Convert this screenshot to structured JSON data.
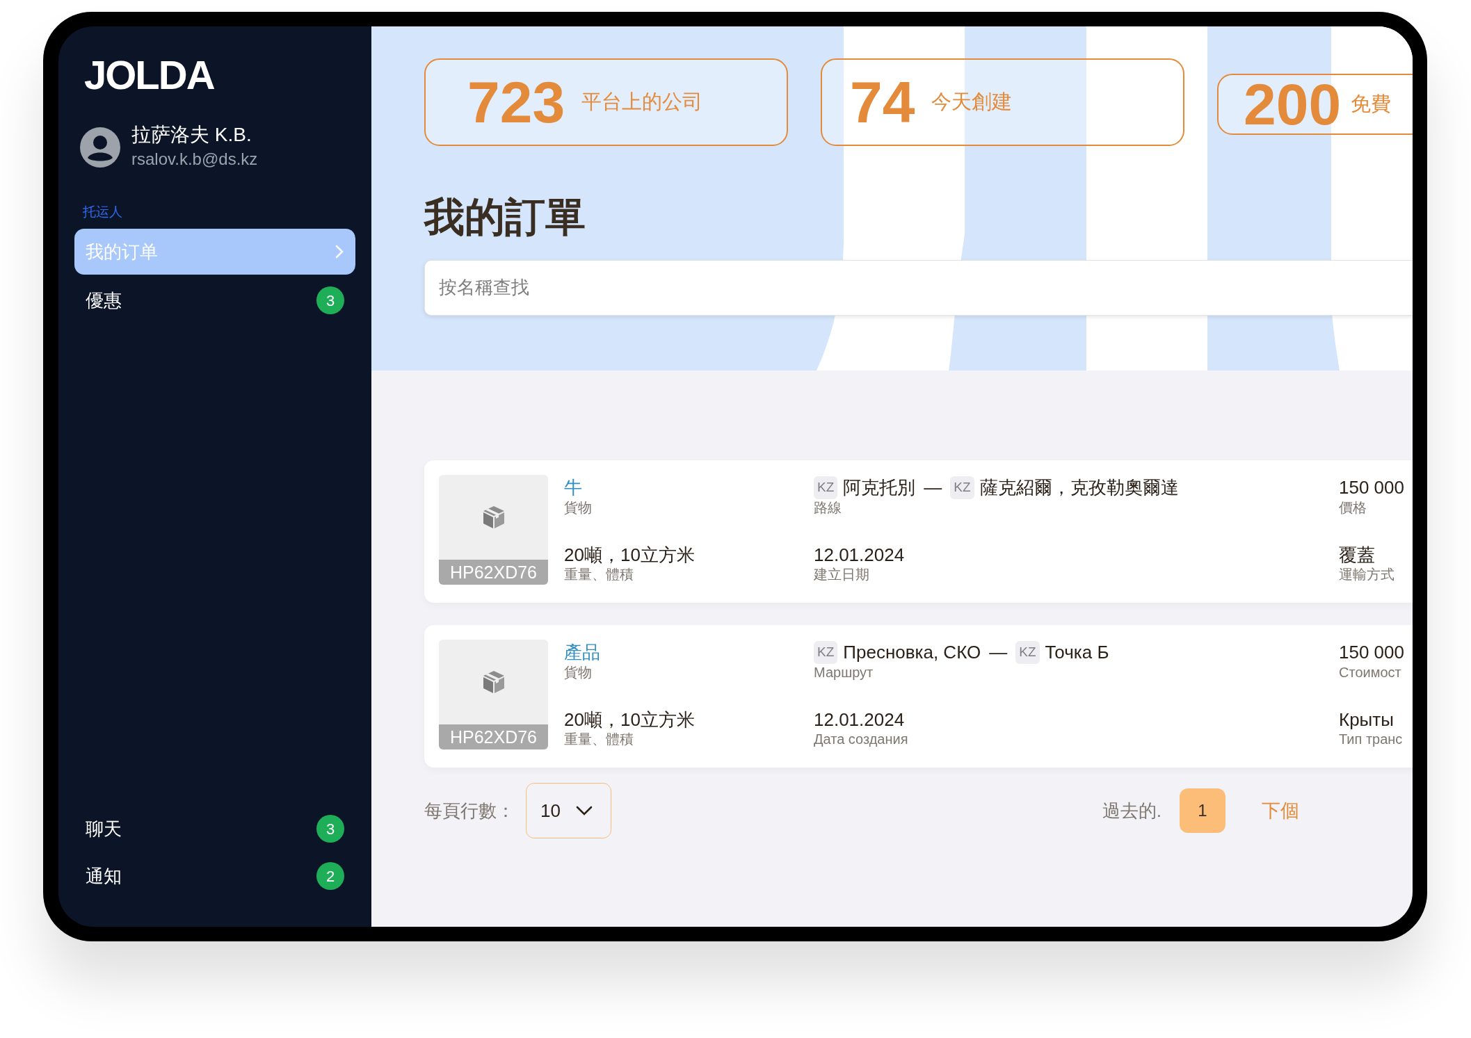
{
  "sidebar": {
    "logo": "JOLDA",
    "user": {
      "name": "拉萨洛夫 K.B.",
      "email": "rsalov.k.b@ds.kz"
    },
    "section_label": "托运人",
    "items": [
      {
        "label": "我的订单",
        "selected": true
      },
      {
        "label": "優惠",
        "selected": false,
        "badge": "3"
      }
    ],
    "bottom_items": [
      {
        "label": "聊天",
        "badge": "3"
      },
      {
        "label": "通知",
        "badge": "2"
      }
    ]
  },
  "stats": [
    {
      "value": "723",
      "label": "平台上的公司"
    },
    {
      "value": "74",
      "label": "今天創建"
    },
    {
      "value": "200",
      "label": "免費"
    }
  ],
  "title": "我的訂單",
  "search": {
    "placeholder": "按名稱查找"
  },
  "orders": [
    {
      "plate": "HP62XD76",
      "cargo": "牛",
      "cargo_label": "貨物",
      "weight": "20噸，10立方米",
      "weight_label": "重量、體積",
      "from_country": "KZ",
      "from": "阿克托別",
      "separator": "—",
      "to_country": "KZ",
      "to": "薩克紹爾，克孜勒奧爾達",
      "route_label": "路線",
      "date": "12.01.2024",
      "date_label": "建立日期",
      "price": "150 000",
      "price_label": "價格",
      "transport": "覆蓋",
      "transport_label": "運輸方式"
    },
    {
      "plate": "HP62XD76",
      "cargo": "產品",
      "cargo_label": "貨物",
      "weight": "20噸，10立方米",
      "weight_label": "重量、體積",
      "from_country": "KZ",
      "from": "Пресновка, СКО",
      "separator": "—",
      "to_country": "KZ",
      "to": "Точка Б",
      "route_label": "Маршрут",
      "date": "12.01.2024",
      "date_label": "Дата создания",
      "price": "150 000",
      "price_label": "Стоимост",
      "transport": "Крыты",
      "transport_label": "Тип транс"
    }
  ],
  "pagination": {
    "rows_label": "每頁行數：",
    "rows_value": "10",
    "prev": "過去的.",
    "pages": [
      {
        "label": "1",
        "selected": true
      }
    ],
    "next": "下個"
  }
}
